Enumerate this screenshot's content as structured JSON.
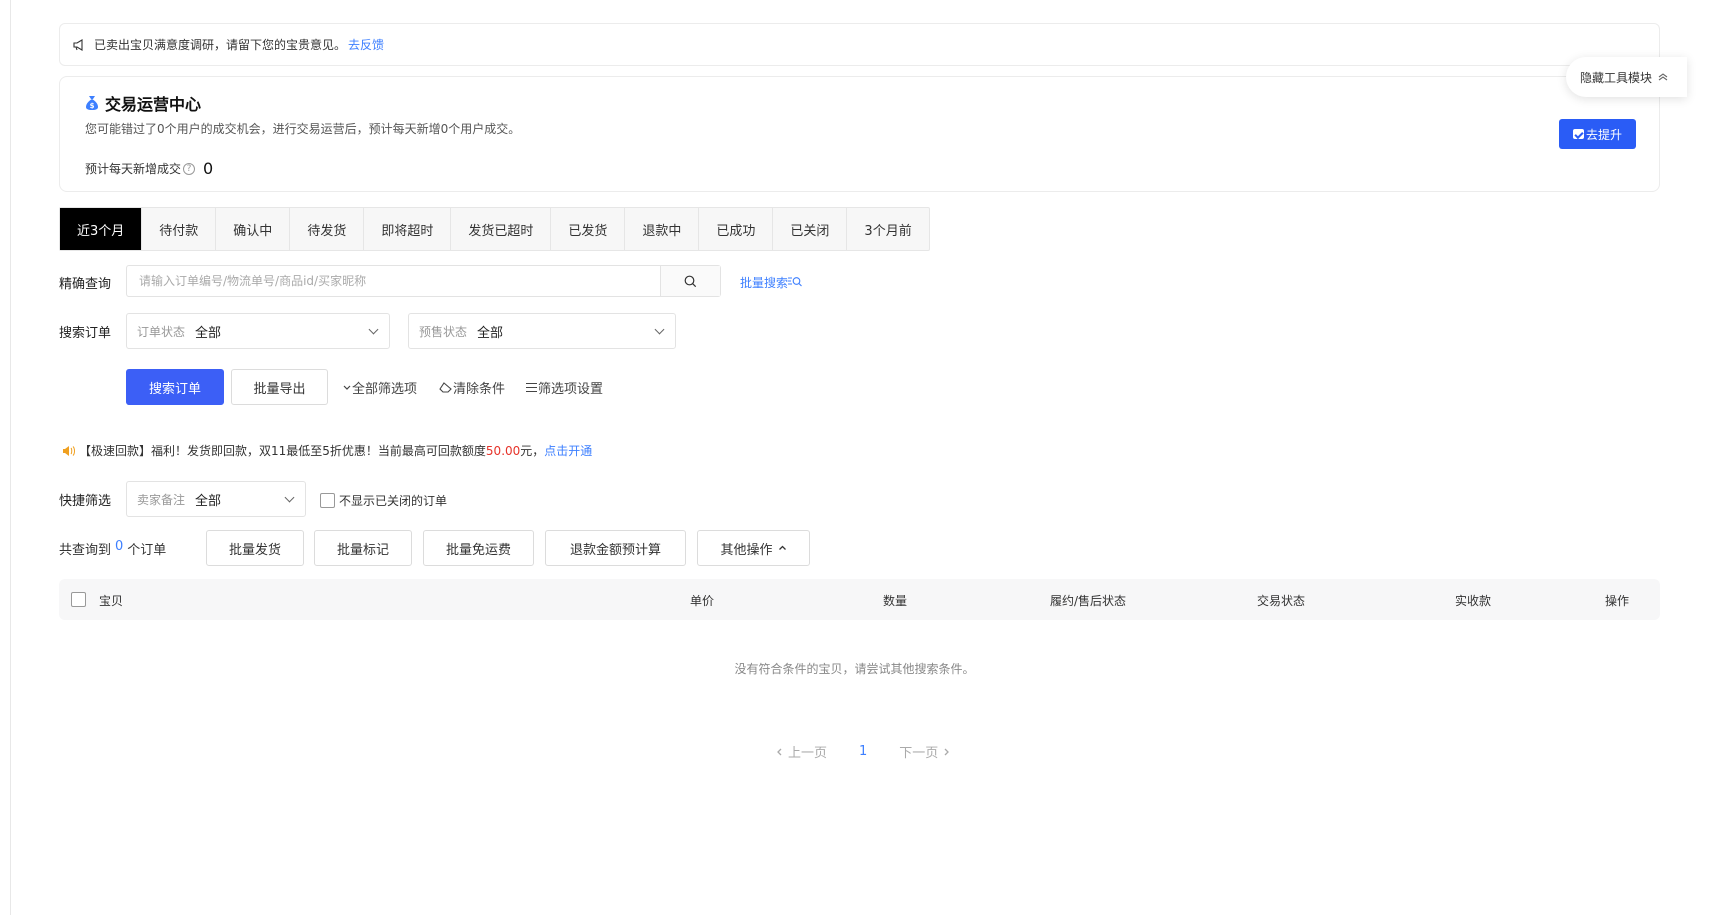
{
  "survey": {
    "text": "已卖出宝贝满意度调研，请留下您的宝贵意见。",
    "link": "去反馈"
  },
  "ops_center": {
    "title": "交易运营中心",
    "description": "您可能错过了0个用户的成交机会，进行交易运营后，预计每天新增0个用户成交。",
    "metric_label": "预计每天新增成交",
    "metric_value": "0",
    "button": "去提升"
  },
  "hide_tools": "隐藏工具模块",
  "tabs": [
    {
      "label": "近3个月",
      "active": true
    },
    {
      "label": "待付款"
    },
    {
      "label": "确认中"
    },
    {
      "label": "待发货"
    },
    {
      "label": "即将超时"
    },
    {
      "label": "发货已超时"
    },
    {
      "label": "已发货"
    },
    {
      "label": "退款中"
    },
    {
      "label": "已成功"
    },
    {
      "label": "已关闭"
    },
    {
      "label": "3个月前"
    }
  ],
  "exact_search": {
    "label": "精确查询",
    "placeholder": "请输入订单编号/物流单号/商品id/买家昵称",
    "batch_link": "批量搜索"
  },
  "search_orders": {
    "label": "搜索订单",
    "order_status": {
      "prefix": "订单状态",
      "value": "全部"
    },
    "presale_status": {
      "prefix": "预售状态",
      "value": "全部"
    }
  },
  "actions": {
    "search": "搜索订单",
    "export": "批量导出",
    "all_filters": "全部筛选项",
    "clear": "清除条件",
    "filter_settings": "筛选项设置"
  },
  "promo": {
    "prefix": "【极速回款】福利！发货即回款，双11最低至5折优惠！当前最高可回款额度",
    "amount": "50.00",
    "suffix": "元，",
    "link": "点击开通"
  },
  "quick_filter": {
    "label": "快捷筛选",
    "seller_note": {
      "prefix": "卖家备注",
      "value": "全部"
    },
    "hide_closed": "不显示已关闭的订单"
  },
  "results": {
    "prefix": "共查询到",
    "count": "0",
    "suffix": "个订单"
  },
  "bulk_actions": {
    "ship": "批量发货",
    "mark": "批量标记",
    "free_shipping": "批量免运费",
    "refund_calc": "退款金额预计算",
    "other": "其他操作"
  },
  "table": {
    "columns": [
      "宝贝",
      "单价",
      "数量",
      "履约/售后状态",
      "交易状态",
      "实收款",
      "操作"
    ]
  },
  "empty_text": "没有符合条件的宝贝，请尝试其他搜索条件。",
  "pagination": {
    "prev": "上一页",
    "current": "1",
    "next": "下一页"
  },
  "colors": {
    "primary": "#3c5ff6",
    "link": "#3d7fff",
    "tab_active_bg": "#000000",
    "amount_red": "#e6332a"
  },
  "icons": [
    "megaphone-icon",
    "money-bag-icon",
    "help-circle-icon",
    "hide-tools-chevron-up-icon",
    "search-icon",
    "batch-search-icon",
    "chevron-down-icon",
    "eraser-icon",
    "list-settings-icon",
    "speaker-icon",
    "chevron-left-icon",
    "chevron-right-icon"
  ]
}
